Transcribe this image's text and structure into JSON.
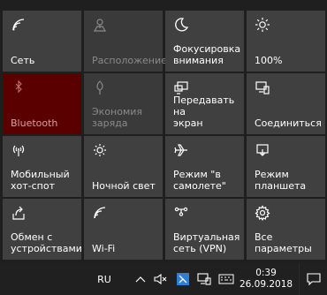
{
  "tiles": [
    {
      "label": "Сеть",
      "icon": "network-wifi-icon",
      "state": "normal"
    },
    {
      "label": "Расположение",
      "icon": "location-icon",
      "state": "disabled"
    },
    {
      "label": "Фокусировка\nвнимания",
      "icon": "moon-icon",
      "state": "normal"
    },
    {
      "label": "100%",
      "icon": "brightness-icon",
      "state": "normal"
    },
    {
      "label": "Bluetooth",
      "icon": "bluetooth-icon",
      "state": "active"
    },
    {
      "label": "Экономия\nзаряда",
      "icon": "battery-saver-icon",
      "state": "disabled"
    },
    {
      "label": "Передавать на\nэкран",
      "icon": "project-icon",
      "state": "normal"
    },
    {
      "label": "Соединиться",
      "icon": "connect-icon",
      "state": "normal"
    },
    {
      "label": "Мобильный\nхот-спот",
      "icon": "hotspot-icon",
      "state": "normal"
    },
    {
      "label": "Ночной свет",
      "icon": "night-light-icon",
      "state": "normal"
    },
    {
      "label": "Режим \"в\nсамолете\"",
      "icon": "airplane-icon",
      "state": "normal"
    },
    {
      "label": "Режим\nпланшета",
      "icon": "tablet-mode-icon",
      "state": "normal"
    },
    {
      "label": "Обмен с\nустройствами",
      "icon": "nearby-share-icon",
      "state": "normal"
    },
    {
      "label": "Wi-Fi",
      "icon": "wifi-icon",
      "state": "normal"
    },
    {
      "label": "Виртуальная\nсеть (VPN)",
      "icon": "vpn-icon",
      "state": "normal"
    },
    {
      "label": "Все параметры",
      "icon": "gear-icon",
      "state": "normal"
    }
  ],
  "taskbar": {
    "language": "RU",
    "time": "0:39",
    "date": "26.09.2018"
  },
  "colors": {
    "tile": "#404040",
    "active_tile": "#5a0000",
    "background": "#1f1f1f",
    "taskbar": "#202020"
  }
}
